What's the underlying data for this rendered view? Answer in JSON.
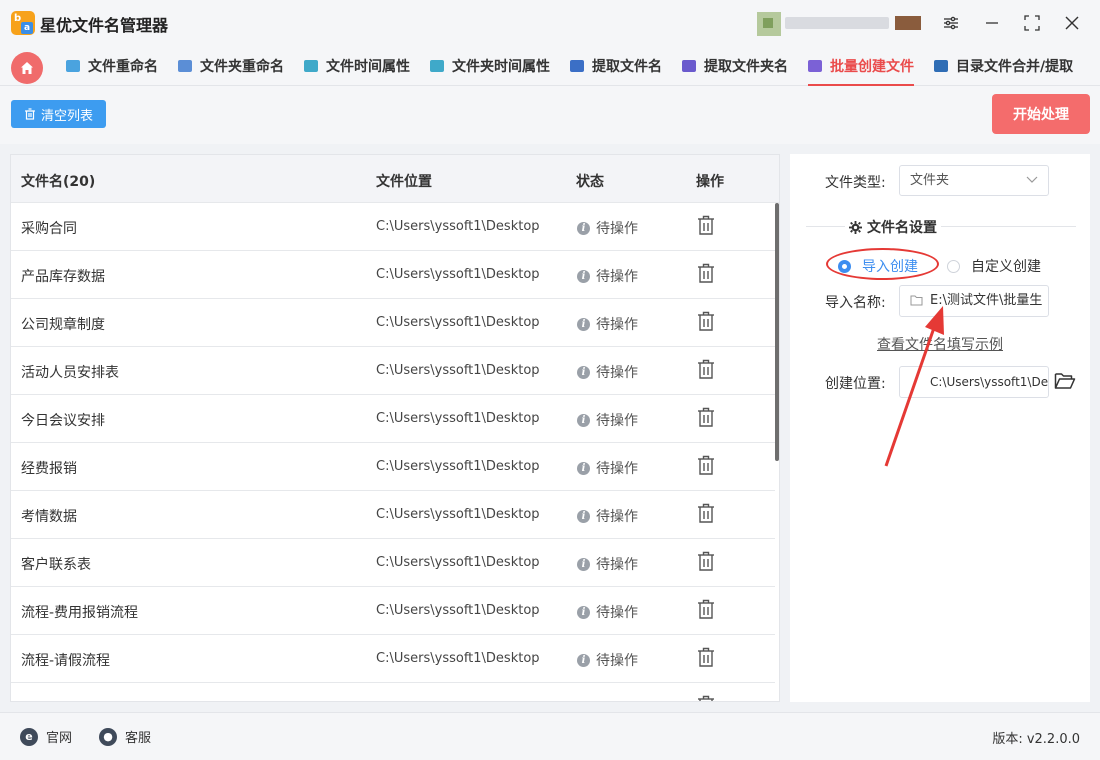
{
  "app": {
    "title": "星优文件名管理器",
    "logo_letters": [
      "b",
      "a"
    ]
  },
  "tabs": [
    {
      "label": "文件重命名",
      "icon": "file-rename-icon",
      "color": "#4aa3df"
    },
    {
      "label": "文件夹重命名",
      "icon": "folder-rename-icon",
      "color": "#5b8ed6"
    },
    {
      "label": "文件时间属性",
      "icon": "file-time-icon",
      "color": "#3fa9c9"
    },
    {
      "label": "文件夹时间属性",
      "icon": "folder-time-icon",
      "color": "#3fa9c9"
    },
    {
      "label": "提取文件名",
      "icon": "extract-file-icon",
      "color": "#3b6fc6"
    },
    {
      "label": "提取文件夹名",
      "icon": "extract-folder-icon",
      "color": "#6a5acd"
    },
    {
      "label": "批量创建文件",
      "icon": "batch-create-icon",
      "color": "#7b61d6",
      "active": true
    },
    {
      "label": "目录文件合并/提取",
      "icon": "directory-merge-icon",
      "color": "#2f6db5"
    }
  ],
  "toolbar": {
    "clear_label": "清空列表",
    "start_label": "开始处理"
  },
  "table": {
    "headers": {
      "name": "文件名(20)",
      "location": "文件位置",
      "status": "状态",
      "action": "操作"
    },
    "rows": [
      {
        "name": "采购合同",
        "location": "C:\\Users\\yssoft1\\Desktop",
        "status": "待操作"
      },
      {
        "name": "产品库存数据",
        "location": "C:\\Users\\yssoft1\\Desktop",
        "status": "待操作"
      },
      {
        "name": "公司规章制度",
        "location": "C:\\Users\\yssoft1\\Desktop",
        "status": "待操作"
      },
      {
        "name": "活动人员安排表",
        "location": "C:\\Users\\yssoft1\\Desktop",
        "status": "待操作"
      },
      {
        "name": "今日会议安排",
        "location": "C:\\Users\\yssoft1\\Desktop",
        "status": "待操作"
      },
      {
        "name": "经费报销",
        "location": "C:\\Users\\yssoft1\\Desktop",
        "status": "待操作"
      },
      {
        "name": "考情数据",
        "location": "C:\\Users\\yssoft1\\Desktop",
        "status": "待操作"
      },
      {
        "name": "客户联系表",
        "location": "C:\\Users\\yssoft1\\Desktop",
        "status": "待操作"
      },
      {
        "name": "流程-费用报销流程",
        "location": "C:\\Users\\yssoft1\\Desktop",
        "status": "待操作"
      },
      {
        "name": "流程-请假流程",
        "location": "C:\\Users\\yssoft1\\Desktop",
        "status": "待操作"
      }
    ]
  },
  "settings": {
    "file_type_label": "文件类型:",
    "file_type_value": "文件夹",
    "section_title": "文件名设置",
    "radio_import": "导入创建",
    "radio_custom": "自定义创建",
    "import_name_label": "导入名称:",
    "import_name_value": "E:\\测试文件\\批量生",
    "example_link": "查看文件名填写示例",
    "create_location_label": "创建位置:",
    "create_location_value": "C:\\Users\\yssoft1\\De"
  },
  "footer": {
    "website_label": "官网",
    "service_label": "客服",
    "version": "版本:  v2.2.0.0"
  },
  "colors": {
    "accent_red": "#ea4b4b",
    "primary_blue": "#3d9cf0",
    "annotation_red": "#e53935"
  }
}
